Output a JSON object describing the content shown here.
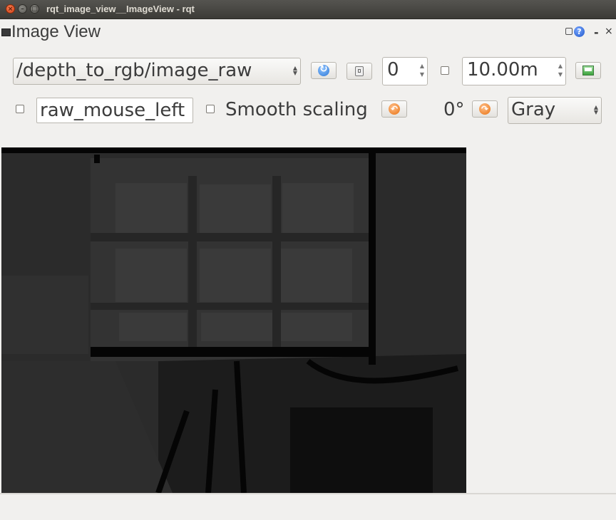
{
  "window": {
    "title": "rqt_image_view__ImageView - rqt",
    "close_glyph": "×",
    "min_glyph": "–",
    "max_glyph": "□"
  },
  "dock": {
    "title": "Image View",
    "help_glyph": "?",
    "minimize_glyph": "-",
    "close_glyph": "×"
  },
  "toolbar": {
    "topic": "/depth_to_rgb/image_raw",
    "topic_arrows": "▲\n▼",
    "spin_value": "0",
    "max_range": "10.00m",
    "spin_arrows": "▲\n▼",
    "mouse_topic": "raw_mouse_left",
    "smooth_scaling_label": "Smooth scaling",
    "rotation_label": "0°",
    "colormap": "Gray",
    "colormap_arrows": "▲\n▼",
    "rotate_left_glyph": "↶",
    "rotate_right_glyph": "↷"
  },
  "colors": {
    "titlebar": "#3c3b37",
    "window_bg": "#f1f0ee",
    "image_bg": "#2a2a2a",
    "close_button": "#e95420"
  },
  "icons": {
    "refresh": "refresh-icon",
    "zoom_fit": "zoom-fit-icon",
    "save": "save-image-icon",
    "rotate_left": "rotate-left-icon",
    "rotate_right": "rotate-right-icon"
  }
}
